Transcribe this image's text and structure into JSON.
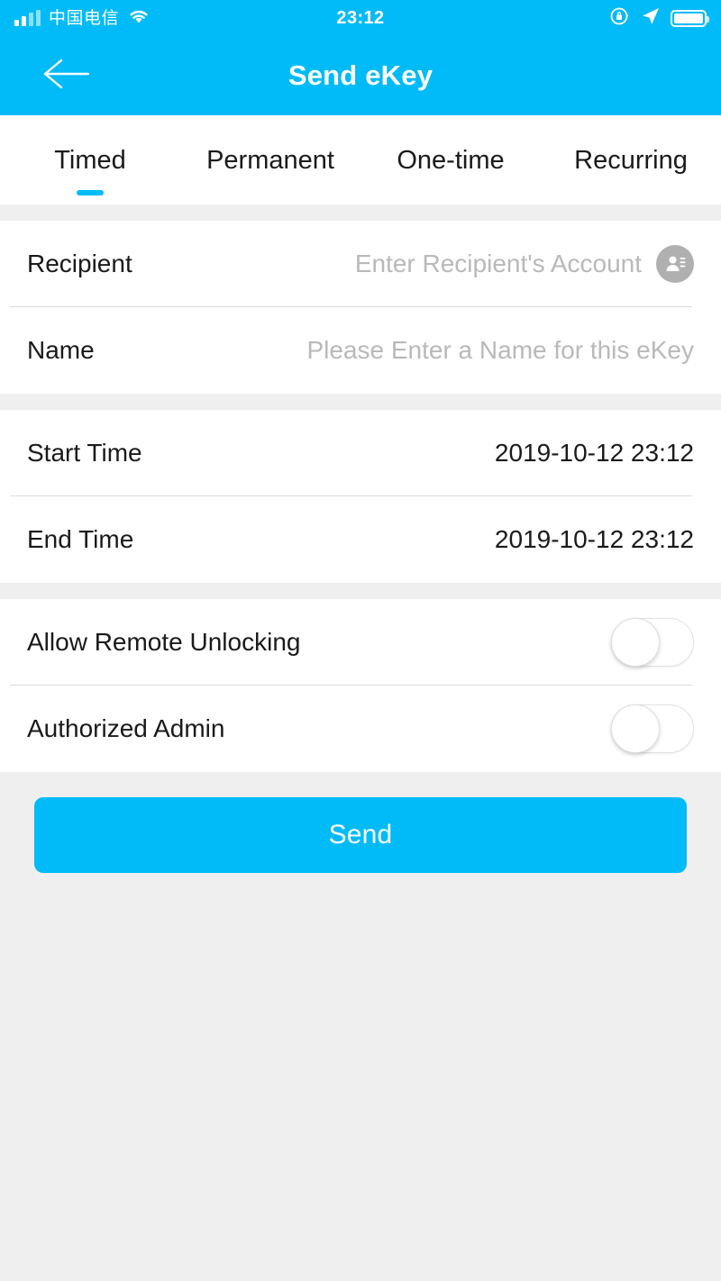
{
  "status_bar": {
    "carrier": "中国电信",
    "time": "23:12",
    "signal_icon": "signal-bars-icon",
    "wifi_icon": "wifi-icon",
    "rotation_lock_icon": "rotation-lock-icon",
    "location_icon": "location-arrow-icon",
    "battery_icon": "battery-icon"
  },
  "nav": {
    "back_icon": "back-arrow-icon",
    "title": "Send eKey"
  },
  "tabs": [
    {
      "label": "Timed",
      "active": true
    },
    {
      "label": "Permanent",
      "active": false
    },
    {
      "label": "One-time",
      "active": false
    },
    {
      "label": "Recurring",
      "active": false
    }
  ],
  "form": {
    "recipient": {
      "label": "Recipient",
      "value": "",
      "placeholder": "Enter Recipient's Account",
      "contact_icon": "contact-picker-icon"
    },
    "name": {
      "label": "Name",
      "value": "",
      "placeholder": "Please Enter a Name for this eKey"
    },
    "start_time": {
      "label": "Start Time",
      "value": "2019-10-12 23:12"
    },
    "end_time": {
      "label": "End Time",
      "value": "2019-10-12 23:12"
    },
    "allow_remote_unlocking": {
      "label": "Allow Remote Unlocking",
      "state": "off"
    },
    "authorized_admin": {
      "label": "Authorized Admin",
      "state": "off"
    }
  },
  "footer": {
    "send_label": "Send"
  },
  "colors": {
    "accent": "#00bbf8",
    "page_background": "#efefef",
    "card_background": "#ffffff",
    "primary_text": "#1a1a1a",
    "placeholder_text": "#b9b9b9",
    "divider": "#dcdcdc"
  }
}
